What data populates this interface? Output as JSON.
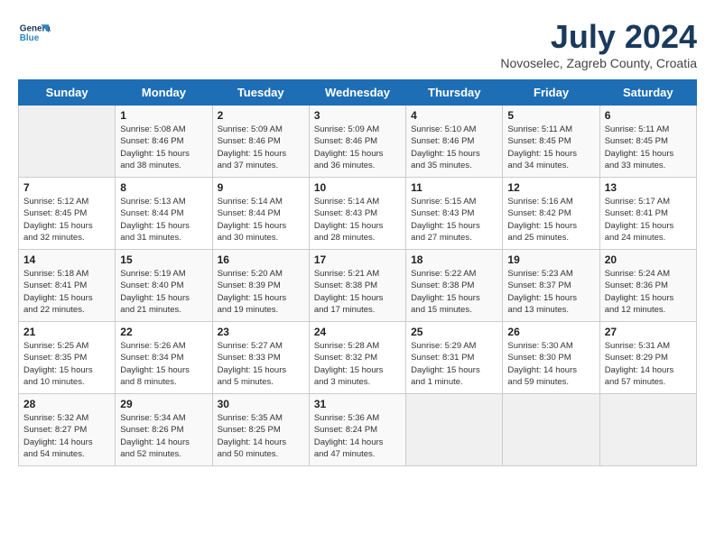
{
  "logo": {
    "line1": "General",
    "line2": "Blue"
  },
  "title": "July 2024",
  "subtitle": "Novoselec, Zagreb County, Croatia",
  "days_header": [
    "Sunday",
    "Monday",
    "Tuesday",
    "Wednesday",
    "Thursday",
    "Friday",
    "Saturday"
  ],
  "weeks": [
    [
      {
        "num": "",
        "detail": ""
      },
      {
        "num": "1",
        "detail": "Sunrise: 5:08 AM\nSunset: 8:46 PM\nDaylight: 15 hours\nand 38 minutes."
      },
      {
        "num": "2",
        "detail": "Sunrise: 5:09 AM\nSunset: 8:46 PM\nDaylight: 15 hours\nand 37 minutes."
      },
      {
        "num": "3",
        "detail": "Sunrise: 5:09 AM\nSunset: 8:46 PM\nDaylight: 15 hours\nand 36 minutes."
      },
      {
        "num": "4",
        "detail": "Sunrise: 5:10 AM\nSunset: 8:46 PM\nDaylight: 15 hours\nand 35 minutes."
      },
      {
        "num": "5",
        "detail": "Sunrise: 5:11 AM\nSunset: 8:45 PM\nDaylight: 15 hours\nand 34 minutes."
      },
      {
        "num": "6",
        "detail": "Sunrise: 5:11 AM\nSunset: 8:45 PM\nDaylight: 15 hours\nand 33 minutes."
      }
    ],
    [
      {
        "num": "7",
        "detail": "Sunrise: 5:12 AM\nSunset: 8:45 PM\nDaylight: 15 hours\nand 32 minutes."
      },
      {
        "num": "8",
        "detail": "Sunrise: 5:13 AM\nSunset: 8:44 PM\nDaylight: 15 hours\nand 31 minutes."
      },
      {
        "num": "9",
        "detail": "Sunrise: 5:14 AM\nSunset: 8:44 PM\nDaylight: 15 hours\nand 30 minutes."
      },
      {
        "num": "10",
        "detail": "Sunrise: 5:14 AM\nSunset: 8:43 PM\nDaylight: 15 hours\nand 28 minutes."
      },
      {
        "num": "11",
        "detail": "Sunrise: 5:15 AM\nSunset: 8:43 PM\nDaylight: 15 hours\nand 27 minutes."
      },
      {
        "num": "12",
        "detail": "Sunrise: 5:16 AM\nSunset: 8:42 PM\nDaylight: 15 hours\nand 25 minutes."
      },
      {
        "num": "13",
        "detail": "Sunrise: 5:17 AM\nSunset: 8:41 PM\nDaylight: 15 hours\nand 24 minutes."
      }
    ],
    [
      {
        "num": "14",
        "detail": "Sunrise: 5:18 AM\nSunset: 8:41 PM\nDaylight: 15 hours\nand 22 minutes."
      },
      {
        "num": "15",
        "detail": "Sunrise: 5:19 AM\nSunset: 8:40 PM\nDaylight: 15 hours\nand 21 minutes."
      },
      {
        "num": "16",
        "detail": "Sunrise: 5:20 AM\nSunset: 8:39 PM\nDaylight: 15 hours\nand 19 minutes."
      },
      {
        "num": "17",
        "detail": "Sunrise: 5:21 AM\nSunset: 8:38 PM\nDaylight: 15 hours\nand 17 minutes."
      },
      {
        "num": "18",
        "detail": "Sunrise: 5:22 AM\nSunset: 8:38 PM\nDaylight: 15 hours\nand 15 minutes."
      },
      {
        "num": "19",
        "detail": "Sunrise: 5:23 AM\nSunset: 8:37 PM\nDaylight: 15 hours\nand 13 minutes."
      },
      {
        "num": "20",
        "detail": "Sunrise: 5:24 AM\nSunset: 8:36 PM\nDaylight: 15 hours\nand 12 minutes."
      }
    ],
    [
      {
        "num": "21",
        "detail": "Sunrise: 5:25 AM\nSunset: 8:35 PM\nDaylight: 15 hours\nand 10 minutes."
      },
      {
        "num": "22",
        "detail": "Sunrise: 5:26 AM\nSunset: 8:34 PM\nDaylight: 15 hours\nand 8 minutes."
      },
      {
        "num": "23",
        "detail": "Sunrise: 5:27 AM\nSunset: 8:33 PM\nDaylight: 15 hours\nand 5 minutes."
      },
      {
        "num": "24",
        "detail": "Sunrise: 5:28 AM\nSunset: 8:32 PM\nDaylight: 15 hours\nand 3 minutes."
      },
      {
        "num": "25",
        "detail": "Sunrise: 5:29 AM\nSunset: 8:31 PM\nDaylight: 15 hours\nand 1 minute."
      },
      {
        "num": "26",
        "detail": "Sunrise: 5:30 AM\nSunset: 8:30 PM\nDaylight: 14 hours\nand 59 minutes."
      },
      {
        "num": "27",
        "detail": "Sunrise: 5:31 AM\nSunset: 8:29 PM\nDaylight: 14 hours\nand 57 minutes."
      }
    ],
    [
      {
        "num": "28",
        "detail": "Sunrise: 5:32 AM\nSunset: 8:27 PM\nDaylight: 14 hours\nand 54 minutes."
      },
      {
        "num": "29",
        "detail": "Sunrise: 5:34 AM\nSunset: 8:26 PM\nDaylight: 14 hours\nand 52 minutes."
      },
      {
        "num": "30",
        "detail": "Sunrise: 5:35 AM\nSunset: 8:25 PM\nDaylight: 14 hours\nand 50 minutes."
      },
      {
        "num": "31",
        "detail": "Sunrise: 5:36 AM\nSunset: 8:24 PM\nDaylight: 14 hours\nand 47 minutes."
      },
      {
        "num": "",
        "detail": ""
      },
      {
        "num": "",
        "detail": ""
      },
      {
        "num": "",
        "detail": ""
      }
    ]
  ]
}
